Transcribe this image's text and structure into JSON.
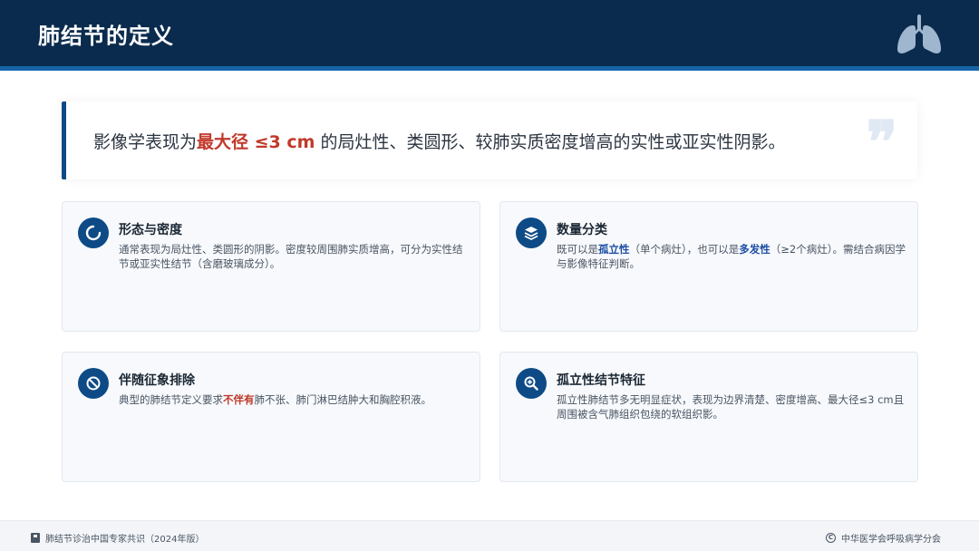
{
  "header": {
    "title": "肺结节的定义",
    "icon": "lungs-icon"
  },
  "quote": {
    "prefix": "影像学表现为",
    "highlight": "最大径 ≤3 cm",
    "suffix": " 的局灶性、类圆形、较肺实质密度增高的实性或亚实性阴影。",
    "mark": "❞"
  },
  "cards": [
    {
      "icon": "circle-notch-icon",
      "title": "形态与密度",
      "body": "通常表现为局灶性、类圆形的阴影。密度较周围肺实质增高，可分为实性结节或亚实性结节（含磨玻璃成分）。"
    },
    {
      "icon": "layers-icon",
      "title": "数量分类",
      "body_1": "既可以是",
      "body_hl_1": "孤立性",
      "body_2": "（单个病灶），也可以是",
      "body_hl_2": "多发性",
      "body_3": "（≥2个病灶）。需结合病因学与影像特征判断。"
    },
    {
      "icon": "ban-icon",
      "title": "伴随征象排除",
      "body_1": "典型的肺结节定义要求",
      "body_hl": "不伴有",
      "body_2": "肺不张、肺门淋巴结肿大和胸腔积液。"
    },
    {
      "icon": "search-plus-icon",
      "title": "孤立性结节特征",
      "body": "孤立性肺结节多无明显症状，表现为边界清楚、密度增高、最大径≤3 cm且周围被含气肺组织包绕的软组织影。"
    }
  ],
  "footer": {
    "left": "肺结节诊治中国专家共识（2024年版）",
    "right": "中华医学会呼吸病学分会"
  },
  "colors": {
    "header_bg": "#0a2b4d",
    "accent": "#0e4a86",
    "highlight_red": "#c0392b",
    "highlight_blue": "#1e4fa3"
  }
}
